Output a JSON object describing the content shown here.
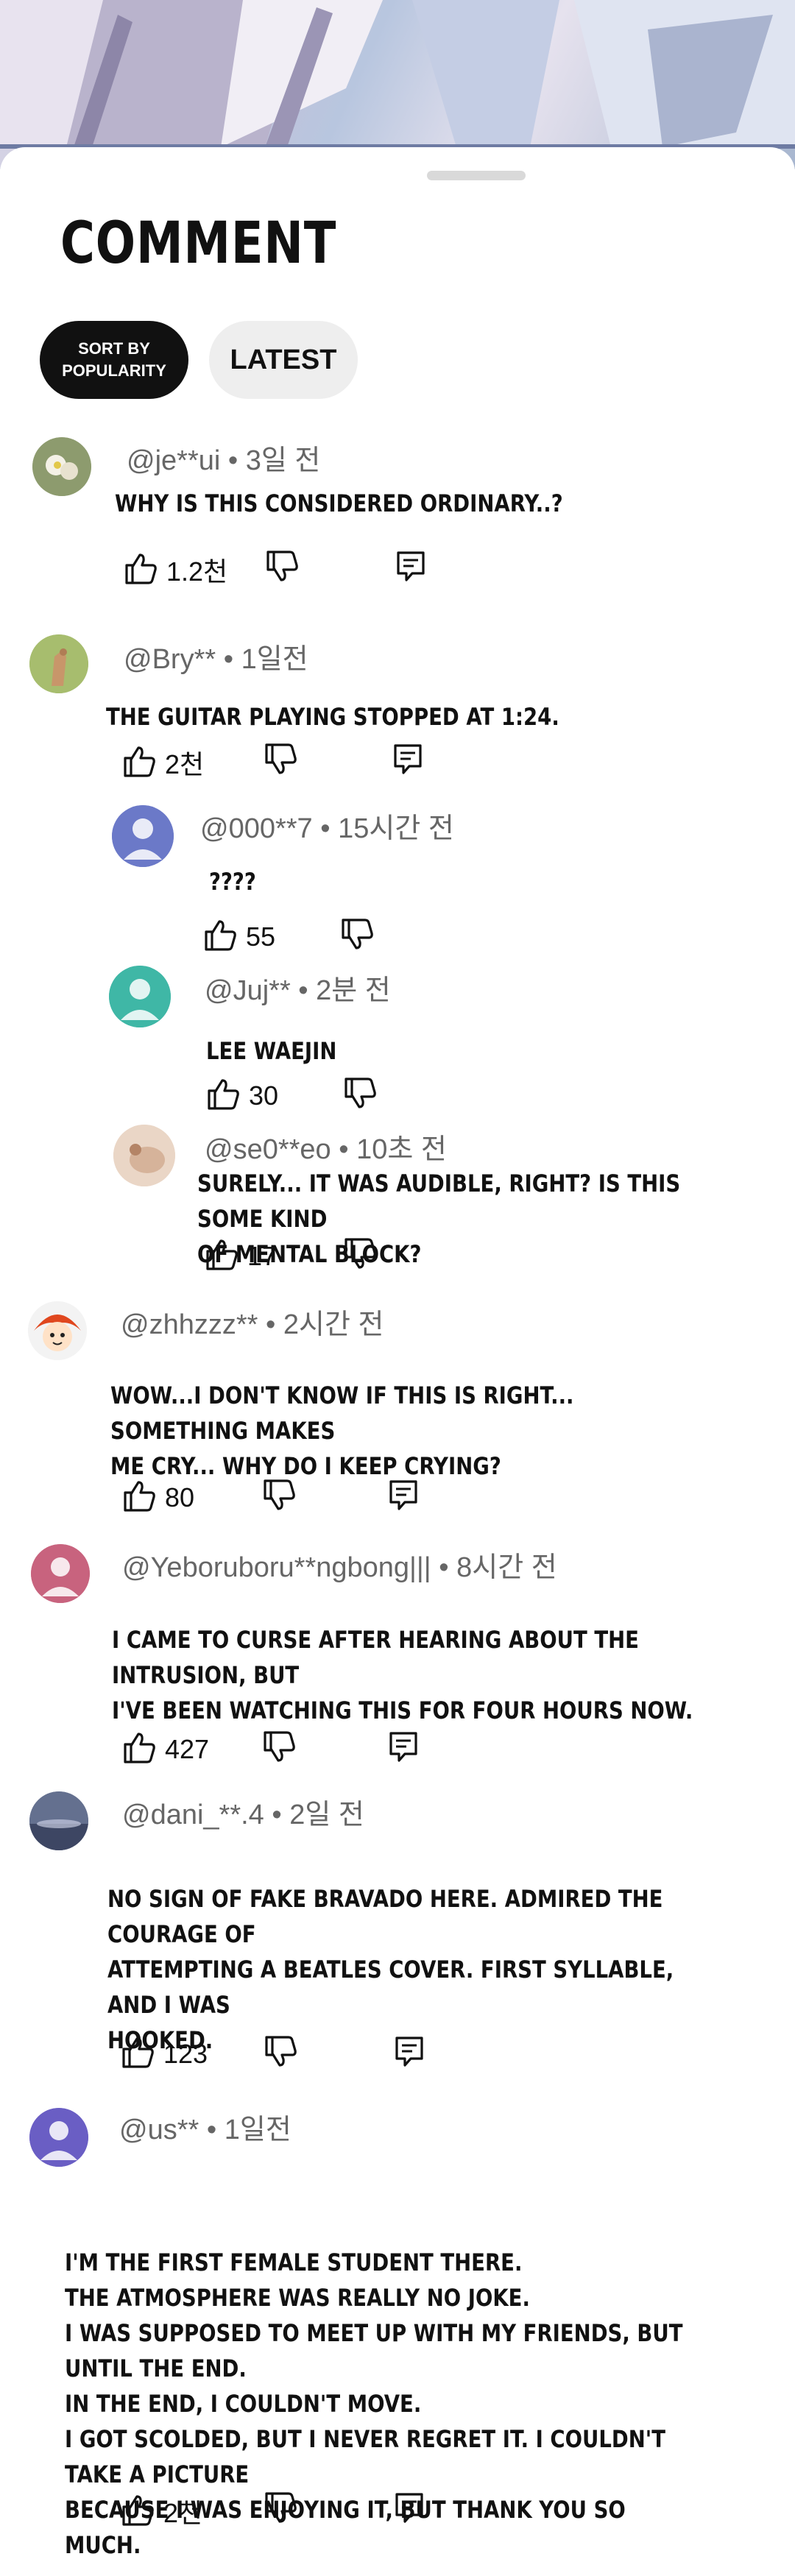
{
  "header": {
    "title": "COMMENT",
    "sort_popularity": "SORT BY\nPOPULARITY",
    "sort_latest": "LATEST"
  },
  "comments": [
    {
      "handle": "@je**ui",
      "time": "• 3일 전",
      "text": "WHY IS THIS CONSIDERED ORDINARY..?",
      "likes": "1.2천"
    },
    {
      "handle": "@Bry**",
      "time": "• 1일전",
      "text": "THE GUITAR PLAYING STOPPED AT 1:24.",
      "likes": "2천"
    },
    {
      "handle": "@000**7",
      "time": "• 15시간 전",
      "text": "????",
      "likes": "55"
    },
    {
      "handle": "@Juj**",
      "time": "• 2분 전",
      "text": "LEE WAEJIN",
      "likes": "30"
    },
    {
      "handle": "@se0**eo",
      "time": "• 10초 전",
      "text": "SURELY... IT WAS AUDIBLE, RIGHT? IS THIS SOME KIND\nOF MENTAL BLOCK?",
      "likes": "17"
    },
    {
      "handle": "@zhhzzz**",
      "time": "• 2시간 전",
      "text": "WOW...I DON'T KNOW IF THIS IS RIGHT... SOMETHING MAKES\nME CRY... WHY DO I KEEP CRYING?",
      "likes": "80"
    },
    {
      "handle": "@Yeboruboru**ngbong|||",
      "time": "• 8시간 전",
      "text": "I CAME TO CURSE AFTER HEARING ABOUT THE INTRUSION, BUT\nI'VE BEEN WATCHING THIS FOR FOUR HOURS NOW.",
      "likes": "427"
    },
    {
      "handle": "@dani_**.4",
      "time": "• 2일 전",
      "text": "NO SIGN OF FAKE BRAVADO HERE. ADMIRED THE COURAGE OF\nATTEMPTING A BEATLES COVER. FIRST SYLLABLE, AND I WAS\nHOOKED.",
      "likes": "123"
    },
    {
      "handle": "@us**",
      "time": "• 1일전",
      "text": "I'M THE FIRST FEMALE STUDENT THERE.\n THE ATMOSPHERE WAS REALLY NO JOKE.\n I WAS SUPPOSED TO MEET UP WITH MY FRIENDS, BUT UNTIL THE END.\nIN THE END, I COULDN'T MOVE.\nI GOT SCOLDED, BUT I NEVER REGRET IT. I COULDN'T TAKE A PICTURE\nBECAUSE I WAS ENJOYING IT, BUT THANK YOU SO MUCH.",
      "likes": "2천"
    }
  ],
  "icons": {
    "like": "thumb-up-icon",
    "dislike": "thumb-down-icon",
    "reply": "reply-icon"
  },
  "colors": {
    "chip_active": "#111111",
    "chip_inactive": "#eeeeee",
    "muted": "#666666"
  }
}
